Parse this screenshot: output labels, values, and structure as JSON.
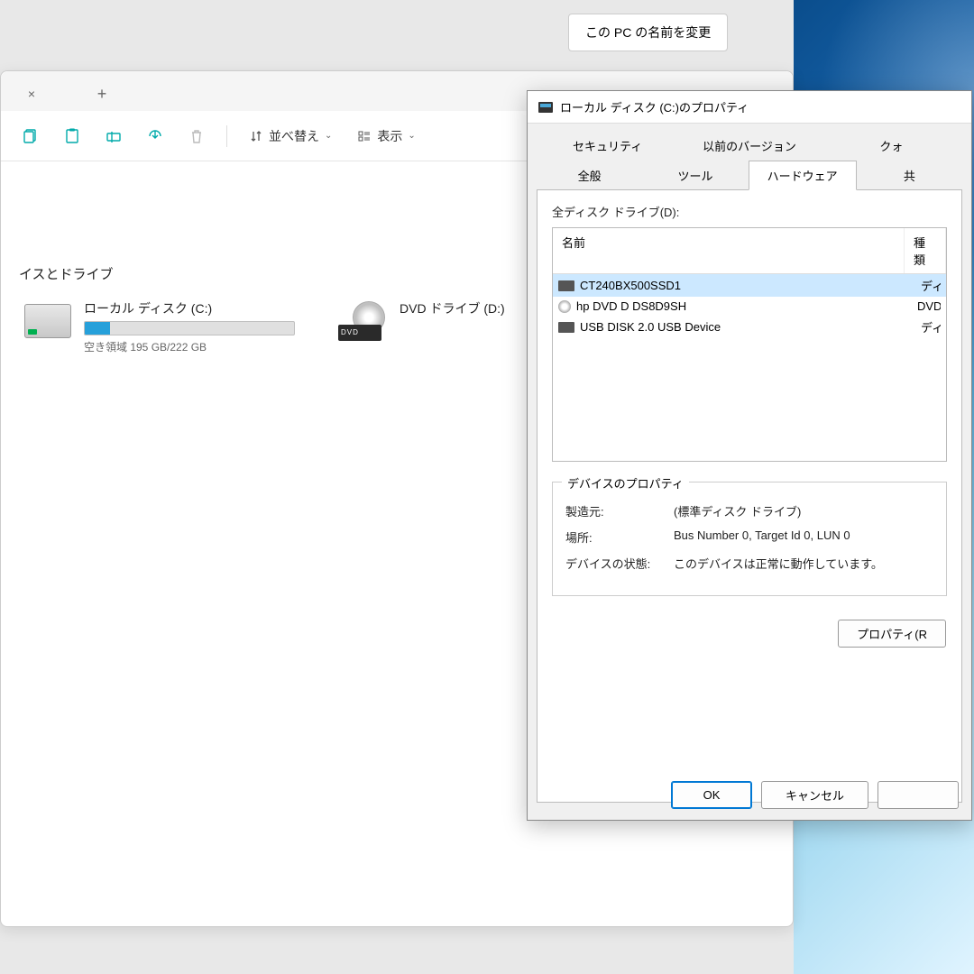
{
  "settings": {
    "rename_pc": "この PC の名前を変更"
  },
  "explorer": {
    "tab_close": "×",
    "tab_new": "+",
    "toolbar": {
      "sort": "並べ替え",
      "view": "表示"
    },
    "section": "イスとドライブ",
    "drives": {
      "c": {
        "name": "ローカル ディスク (C:)",
        "free_text": "空き領域 195 GB/222 GB",
        "used_percent": 12
      },
      "d": {
        "name": "DVD ドライブ (D:)"
      }
    }
  },
  "dialog": {
    "title": "ローカル ディスク (C:)のプロパティ",
    "tabs_bottom": [
      "全般",
      "ツール",
      "ハードウェア",
      "共"
    ],
    "tabs_top": [
      "セキュリティ",
      "以前のバージョン",
      "クォ"
    ],
    "active_tab": "ハードウェア",
    "all_drives_label": "全ディスク ドライブ(D):",
    "columns": {
      "name": "名前",
      "type": "種類"
    },
    "drives": [
      {
        "name": "CT240BX500SSD1",
        "type": "ディスク ドライ",
        "icon": "disk",
        "selected": true
      },
      {
        "name": "hp DVD D  DS8D9SH",
        "type": "DVD/CD-RO",
        "icon": "dvd",
        "selected": false
      },
      {
        "name": "USB DISK 2.0 USB Device",
        "type": "ディスク ドライ",
        "icon": "disk",
        "selected": false
      }
    ],
    "device_props": {
      "legend": "デバイスのプロパティ",
      "manufacturer_k": "製造元:",
      "manufacturer_v": "(標準ディスク ドライブ)",
      "location_k": "場所:",
      "location_v": "Bus Number 0, Target Id 0, LUN 0",
      "status_k": "デバイスの状態:",
      "status_v": "このデバイスは正常に動作しています。",
      "properties_btn": "プロパティ(R"
    },
    "buttons": {
      "ok": "OK",
      "cancel": "キャンセル",
      "apply": ""
    }
  }
}
